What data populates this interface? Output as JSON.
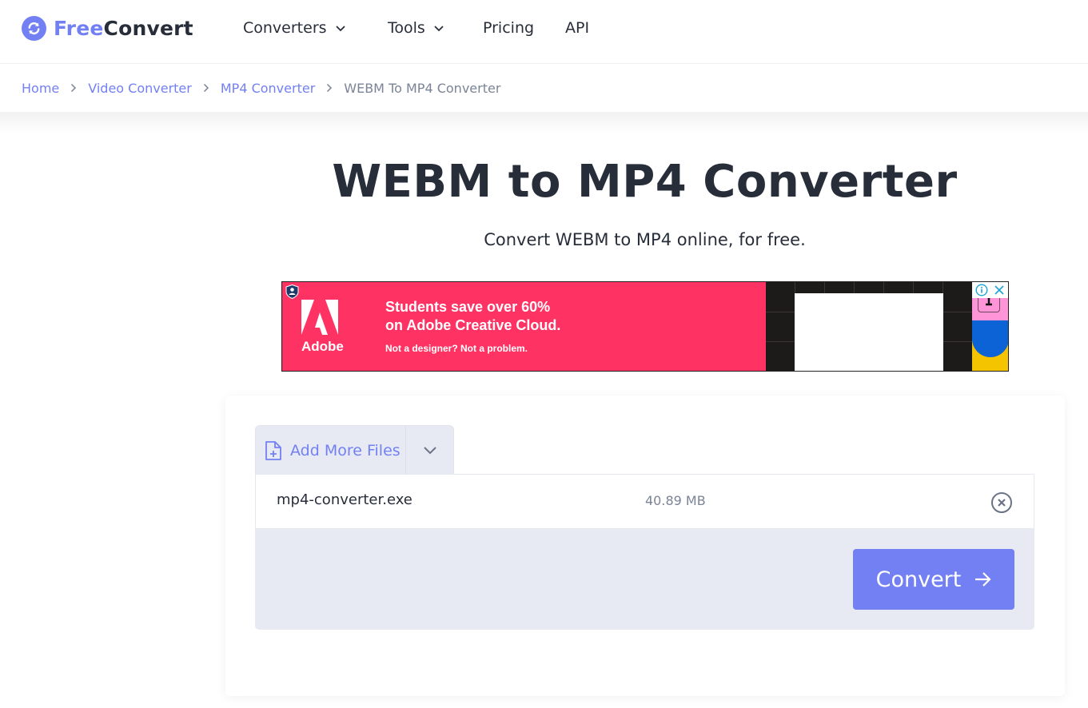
{
  "brand": {
    "name_part1": "Free",
    "name_part2": "Convert",
    "accent": "#7380f3",
    "text": "#272e3a"
  },
  "nav": {
    "items": [
      {
        "label": "Converters",
        "has_dropdown": true
      },
      {
        "label": "Tools",
        "has_dropdown": true
      },
      {
        "label": "Pricing",
        "has_dropdown": false
      },
      {
        "label": "API",
        "has_dropdown": false
      }
    ]
  },
  "breadcrumb": {
    "items": [
      "Home",
      "Video Converter",
      "MP4 Converter"
    ],
    "current": "WEBM To MP4 Converter"
  },
  "hero": {
    "title": "WEBM to MP4 Converter",
    "subtitle": "Convert WEBM to MP4 online, for free."
  },
  "ad": {
    "brand": "Adobe",
    "headline_line1": "Students save over 60%",
    "headline_line2": "on Adobe Creative Cloud.",
    "subline": "Not a designer? Not a problem.",
    "background": "#ff3363"
  },
  "uploader": {
    "add_more_label": "Add More Files",
    "files": [
      {
        "name": "mp4-converter.exe",
        "size": "40.89 MB"
      }
    ],
    "convert_label": "Convert"
  }
}
